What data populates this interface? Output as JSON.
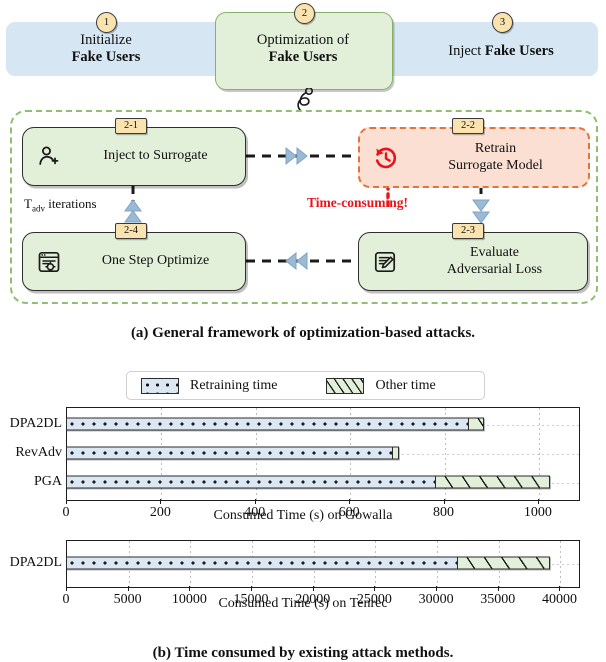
{
  "framework": {
    "stages": [
      {
        "num": "1",
        "line1": "Initialize",
        "line2": "Fake Users"
      },
      {
        "num": "2",
        "line1": "Optimization of",
        "line2": "Fake Users"
      },
      {
        "num": "3",
        "line1": "Inject ",
        "line2": "Fake Users"
      }
    ],
    "nodes": [
      {
        "tag": "2-1",
        "line1": "Inject to Surrogate",
        "line2": "",
        "icon": "person-add-icon"
      },
      {
        "tag": "2-2",
        "line1": "Retrain",
        "line2": "Surrogate Model",
        "icon": "clock-history-icon"
      },
      {
        "tag": "2-3",
        "line1": "Evaluate",
        "line2": "Adversarial Loss",
        "icon": "document-edit-icon"
      },
      {
        "tag": "2-4",
        "line1": "One Step Optimize",
        "line2": "",
        "icon": "window-settings-icon"
      }
    ],
    "loop_label_prefix": "T",
    "loop_label_sub": "adv",
    "loop_label_suffix": " iterations",
    "warning": "Time-consuming!",
    "colors": {
      "banner": "#d6e6f2",
      "green_node": "#e2efd9",
      "green_border": "#86b06a",
      "red_node": "#fadfd2",
      "red_border": "#e0753c",
      "warning_text": "#e8141c",
      "tag": "#fbe3b0"
    }
  },
  "caption_a": "(a) General framework of optimization-based attacks.",
  "caption_b": "(b) Time consumed by existing attack methods.",
  "legend": {
    "entries": [
      {
        "label": "Retraining time",
        "pattern": "dotted",
        "color": "#dbe7f2"
      },
      {
        "label": "Other time",
        "pattern": "hatched",
        "color": "#e2efd9"
      }
    ]
  },
  "chart_data": [
    {
      "type": "bar",
      "orientation": "horizontal",
      "stacked": true,
      "title": "",
      "xlabel": "Consumed Time (s) on Gowalla",
      "ylabel": "",
      "categories": [
        "DPA2DL",
        "RevAdv",
        "PGA"
      ],
      "series": [
        {
          "name": "Retraining time",
          "values": [
            855,
            693,
            785
          ]
        },
        {
          "name": "Other time",
          "values": [
            30,
            13,
            240
          ]
        }
      ],
      "totals": [
        885,
        706,
        1025
      ],
      "xlim": [
        0,
        1085
      ],
      "xticks": [
        0,
        200,
        400,
        600,
        800,
        1000
      ],
      "grid": true,
      "legend_position": "above"
    },
    {
      "type": "bar",
      "orientation": "horizontal",
      "stacked": true,
      "title": "",
      "xlabel": "Consumed Time (s) on Tenrec",
      "ylabel": "",
      "categories": [
        "DPA2DL"
      ],
      "series": [
        {
          "name": "Retraining time",
          "values": [
            31800
          ]
        },
        {
          "name": "Other time",
          "values": [
            7400
          ]
        }
      ],
      "totals": [
        39200
      ],
      "xlim": [
        0,
        41500
      ],
      "xticks": [
        0,
        5000,
        10000,
        15000,
        20000,
        25000,
        30000,
        35000,
        40000
      ],
      "grid": true,
      "legend_position": "shared-above"
    }
  ]
}
